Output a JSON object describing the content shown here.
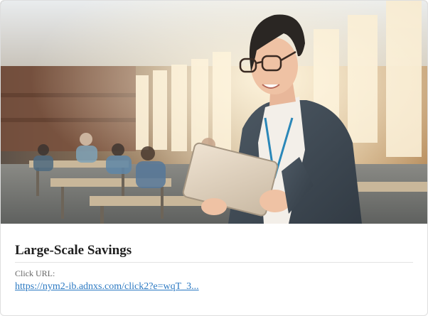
{
  "card": {
    "title": "Large-Scale Savings",
    "click_url_label": "Click URL:",
    "click_url_text": "https://nym2-ib.adnxs.com/click2?e=wqT_3..."
  },
  "colors": {
    "title": "#1f1f1f",
    "label": "#666666",
    "link": "#2a78c2",
    "divider": "#e3e3e3"
  },
  "image": {
    "subject": "teacher-holding-tablet-in-classroom"
  }
}
